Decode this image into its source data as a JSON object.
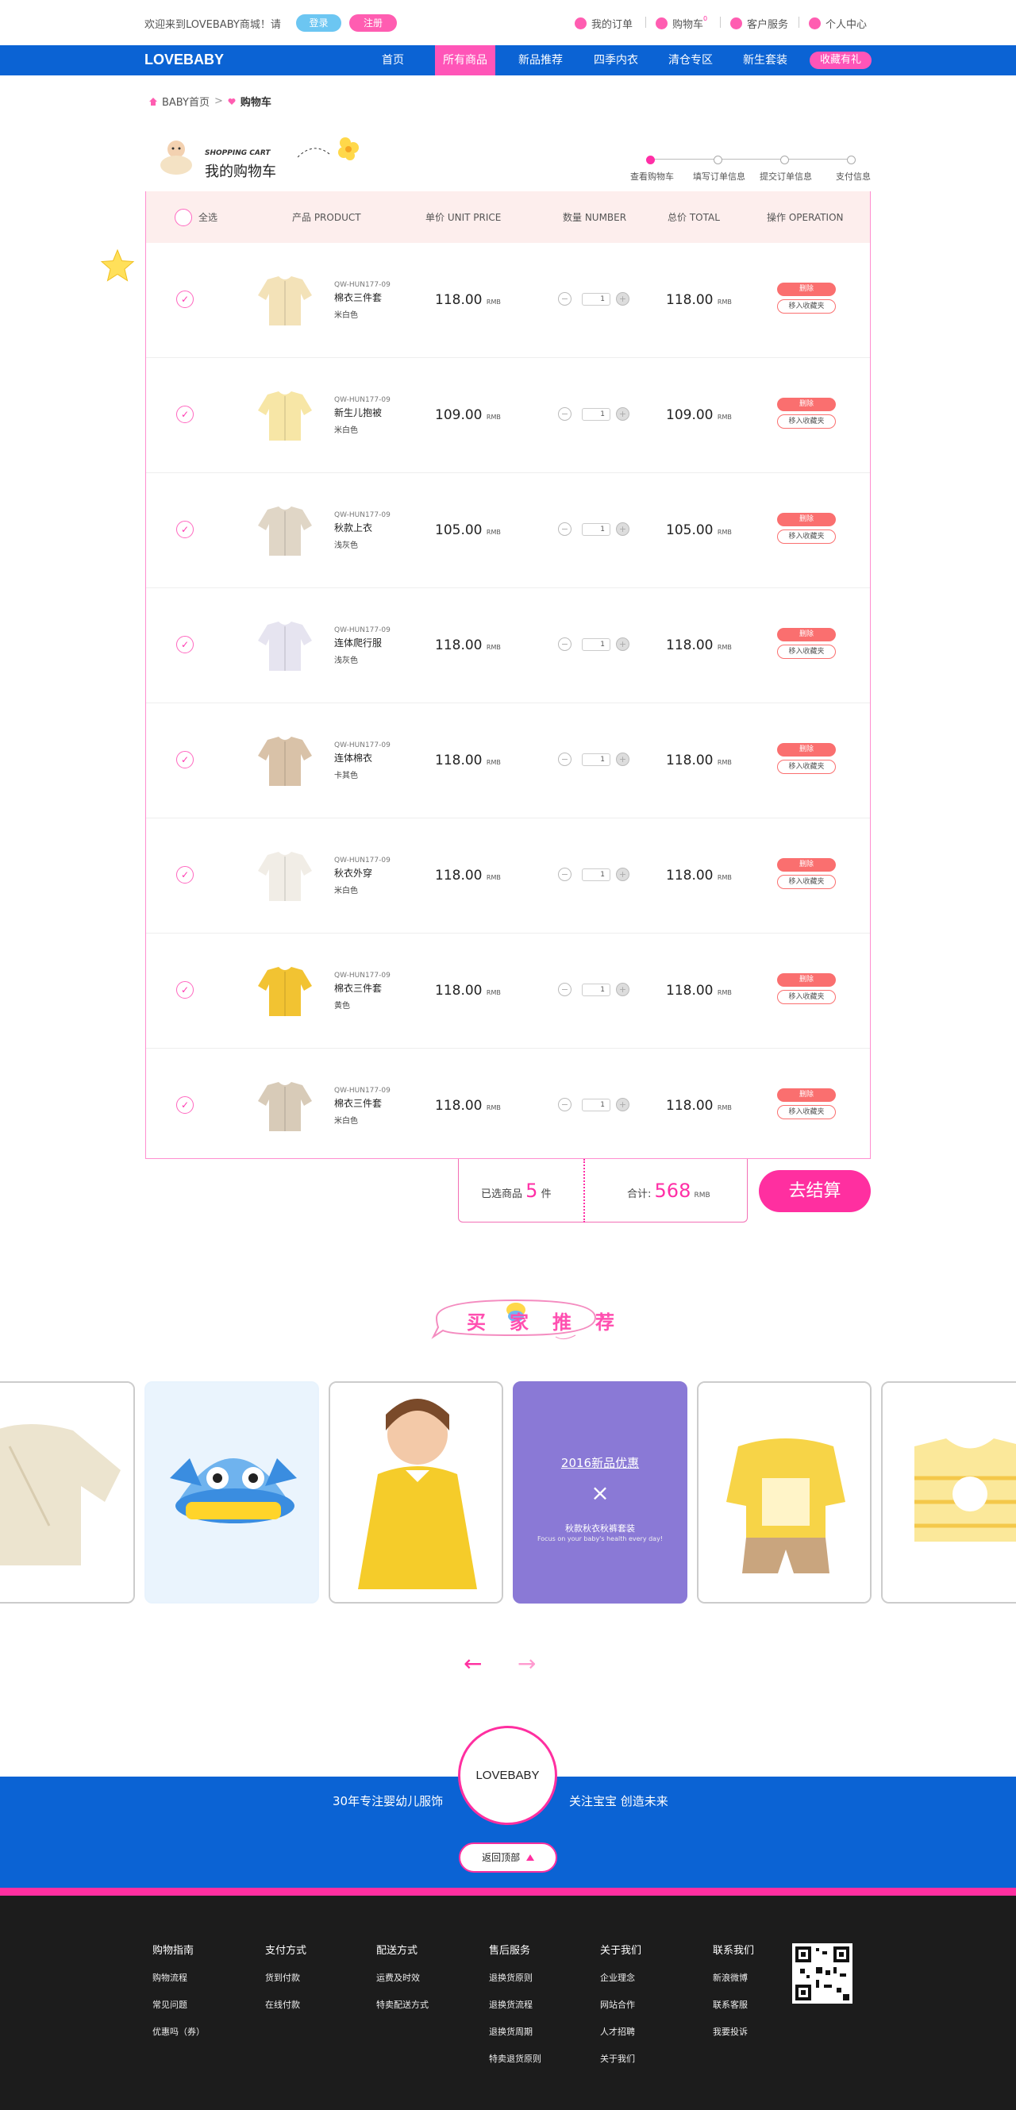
{
  "topbar": {
    "welcome": "欢迎来到LOVEBABY商城！请",
    "login": "登录",
    "register": "注册",
    "links": [
      "我的订单",
      "购物车",
      "客户服务",
      "个人中心"
    ],
    "cart_badge": "0"
  },
  "nav": {
    "logo": "LOVEBABY",
    "items": [
      "首页",
      "所有商品",
      "新品推荐",
      "四季内衣",
      "清仓专区",
      "新生套装"
    ],
    "active": "所有商品",
    "fav": "收藏有礼"
  },
  "breadcrumb": {
    "home": "BABY首页",
    "sep": ">",
    "current": "购物车"
  },
  "cart_title": {
    "en": "SHOPPING CART",
    "cn": "我的购物车"
  },
  "steps": [
    "查看购物车",
    "填写订单信息",
    "提交订单信息",
    "支付信息"
  ],
  "table": {
    "headers": [
      "全选",
      "产品 PRODUCT",
      "单价 UNIT PRICE",
      "数量 NUMBER",
      "总价 TOTAL",
      "操作 OPERATION"
    ],
    "currency": "RMB",
    "delete_label": "删除",
    "fav_label": "移入收藏夹",
    "check": "✓",
    "minus": "−",
    "plus": "+",
    "rows": [
      {
        "code": "QW-HUN177-09",
        "name": "棉衣三件套",
        "color": "米白色",
        "price": "118.00",
        "qty": "1",
        "total": "118.00",
        "swatch": "#f3e2b8"
      },
      {
        "code": "QW-HUN177-09",
        "name": "新生儿抱被",
        "color": "米白色",
        "price": "109.00",
        "qty": "1",
        "total": "109.00",
        "swatch": "#f7e6a6"
      },
      {
        "code": "QW-HUN177-09",
        "name": "秋款上衣",
        "color": "浅灰色",
        "price": "105.00",
        "qty": "1",
        "total": "105.00",
        "swatch": "#e0d6c6"
      },
      {
        "code": "QW-HUN177-09",
        "name": "连体爬行服",
        "color": "浅灰色",
        "price": "118.00",
        "qty": "1",
        "total": "118.00",
        "swatch": "#e6e4f0"
      },
      {
        "code": "QW-HUN177-09",
        "name": "连体棉衣",
        "color": "卡其色",
        "price": "118.00",
        "qty": "1",
        "total": "118.00",
        "swatch": "#d9c2a8"
      },
      {
        "code": "QW-HUN177-09",
        "name": "秋衣外穿",
        "color": "米白色",
        "price": "118.00",
        "qty": "1",
        "total": "118.00",
        "swatch": "#f1ede6"
      },
      {
        "code": "QW-HUN177-09",
        "name": "棉衣三件套",
        "color": "黄色",
        "price": "118.00",
        "qty": "1",
        "total": "118.00",
        "swatch": "#f2c332"
      },
      {
        "code": "QW-HUN177-09",
        "name": "棉衣三件套",
        "color": "米白色",
        "price": "118.00",
        "qty": "1",
        "total": "118.00",
        "swatch": "#d8cbb8"
      }
    ]
  },
  "summary": {
    "selected_label": "已选商品",
    "count": "5",
    "unit": "件",
    "total_label": "合计:",
    "total": "568",
    "currency": "RMB",
    "checkout": "去结算"
  },
  "recommend": {
    "title": "买家推荐",
    "promo_title": "2016新品优惠",
    "promo_close": "×",
    "promo_sub": "秋款秋衣秋裤套装",
    "promo_en": "Focus on your baby's health every day!",
    "arrow_prev": "←",
    "arrow_next": "→"
  },
  "band": {
    "left": "30年专注婴幼儿服饰",
    "right": "关注宝宝  创造未来",
    "logo": "LOVEBABY",
    "backtop": "返回顶部"
  },
  "footer": {
    "cols": [
      {
        "h": "购物指南",
        "items": [
          "购物流程",
          "常见问题",
          "优惠吗（券）"
        ]
      },
      {
        "h": "支付方式",
        "items": [
          "货到付款",
          "在线付款"
        ]
      },
      {
        "h": "配送方式",
        "items": [
          "运费及时效",
          "特卖配送方式"
        ]
      },
      {
        "h": "售后服务",
        "items": [
          "退换货原则",
          "退换货流程",
          "退换货周期",
          "特卖退货原则"
        ]
      },
      {
        "h": "关于我们",
        "items": [
          "企业理念",
          "网站合作",
          "人才招聘",
          "关于我们"
        ]
      },
      {
        "h": "联系我们",
        "items": [
          "新浪微博",
          "联系客服",
          "我要投诉"
        ]
      }
    ]
  },
  "colors": {
    "brand_blue": "#0b63d4",
    "brand_pink": "#ff2fa0",
    "header_bg": "#fdeeed",
    "delete_red": "#fa6f6f"
  }
}
